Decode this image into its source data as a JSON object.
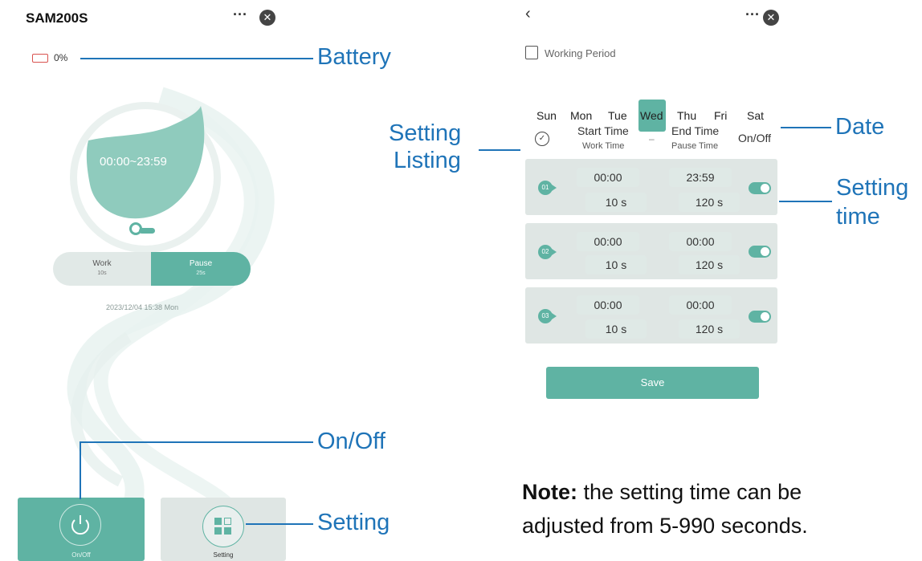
{
  "left": {
    "title": "SAM200S",
    "battery": "0%",
    "time_range": "00:00~23:59",
    "work": {
      "label": "Work",
      "value": "10s"
    },
    "pause": {
      "label": "Pause",
      "value": "25s"
    },
    "datetime": "2023/12/04 15:38 Mon",
    "onoff_label": "On/Off",
    "setting_label": "Setting"
  },
  "right": {
    "working_period": "Working Period",
    "days": [
      "Sun",
      "Mon",
      "Tue",
      "Wed",
      "Thu",
      "Fri",
      "Sat"
    ],
    "selected_day": "Wed",
    "header": {
      "start": "Start Time",
      "start_sub": "Work Time",
      "dash": "–",
      "end": "End Time",
      "end_sub": "Pause Time",
      "onoff": "On/Off"
    },
    "rows": [
      {
        "num": "01",
        "start": "00:00",
        "end": "23:59",
        "work": "10 s",
        "pause": "120 s",
        "on": true
      },
      {
        "num": "02",
        "start": "00:00",
        "end": "00:00",
        "work": "10 s",
        "pause": "120 s",
        "on": true
      },
      {
        "num": "03",
        "start": "00:00",
        "end": "00:00",
        "work": "10 s",
        "pause": "120 s",
        "on": true
      }
    ],
    "save_label": "Save"
  },
  "callouts": {
    "battery": "Battery",
    "onoff": "On/Off",
    "setting": "Setting",
    "setting_listing_1": "Setting",
    "setting_listing_2": "Listing",
    "date": "Date",
    "setting_time_1": "Setting",
    "setting_time_2": "time"
  },
  "note": {
    "bold": "Note:",
    "line1": " the setting time can be",
    "line2": "adjusted from 5-990 seconds."
  },
  "colors": {
    "accent": "#5fb3a3",
    "callout": "#1f74b8",
    "card": "#dfe6e4"
  }
}
